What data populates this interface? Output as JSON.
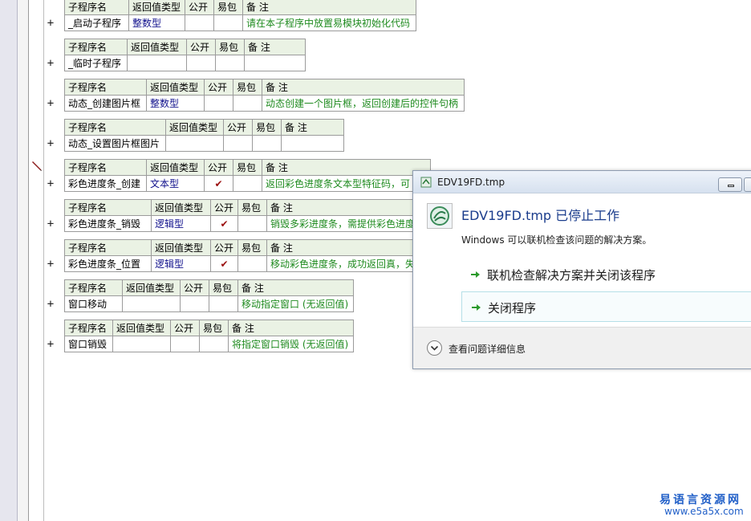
{
  "headers": {
    "name": "子程序名",
    "ret": "返回值类型",
    "pub": "公开",
    "easy": "易包",
    "note": "备 注"
  },
  "rows": [
    {
      "name": "_启动子程序",
      "ret": "整数型",
      "pub": "",
      "easy": "",
      "note": "请在本子程序中放置易模块初始化代码"
    },
    {
      "name": "_临时子程序",
      "ret": "",
      "pub": "",
      "easy": "",
      "note": ""
    },
    {
      "name": "动态_创建图片框",
      "ret": "整数型",
      "pub": "",
      "easy": "",
      "note": "动态创建一个图片框，返回创建后的控件句柄"
    },
    {
      "name": "动态_设置图片框图片",
      "ret": "",
      "pub": "",
      "easy": "",
      "note": ""
    },
    {
      "name": "彩色进度条_创建",
      "ret": "文本型",
      "pub": "✔",
      "easy": "",
      "note": "返回彩色进度条文本型特征码，可"
    },
    {
      "name": "彩色进度条_销毁",
      "ret": "逻辑型",
      "pub": "✔",
      "easy": "",
      "note": "销毁多彩进度条，需提供彩色进度"
    },
    {
      "name": "彩色进度条_位置",
      "ret": "逻辑型",
      "pub": "✔",
      "easy": "",
      "note": "移动彩色进度条，成功返回真，失"
    },
    {
      "name": "窗口移动",
      "ret": "",
      "pub": "",
      "easy": "",
      "note": "移动指定窗口 (无返回值)"
    },
    {
      "name": "窗口销毁",
      "ret": "",
      "pub": "",
      "easy": "",
      "note": "将指定窗口销毁 (无返回值)"
    }
  ],
  "expander": "+",
  "dialog": {
    "title": "EDV19FD.tmp",
    "heading": "EDV19FD.tmp 已停止工作",
    "desc": "Windows 可以联机检查该问题的解决方案。",
    "option1": "联机检查解决方案并关闭该程序",
    "option2": "关闭程序",
    "details": "查看问题详细信息"
  },
  "watermark": {
    "line1": "易语言资源网",
    "line2": "www.e5a5x.com"
  },
  "colors": {
    "header_bg": "#eaf2e4",
    "type_text": "#10108c",
    "note_text": "#1e8a1e",
    "check_mark": "#9b1010",
    "dialog_heading": "#1a3c8c",
    "watermark": "#2260c8"
  }
}
